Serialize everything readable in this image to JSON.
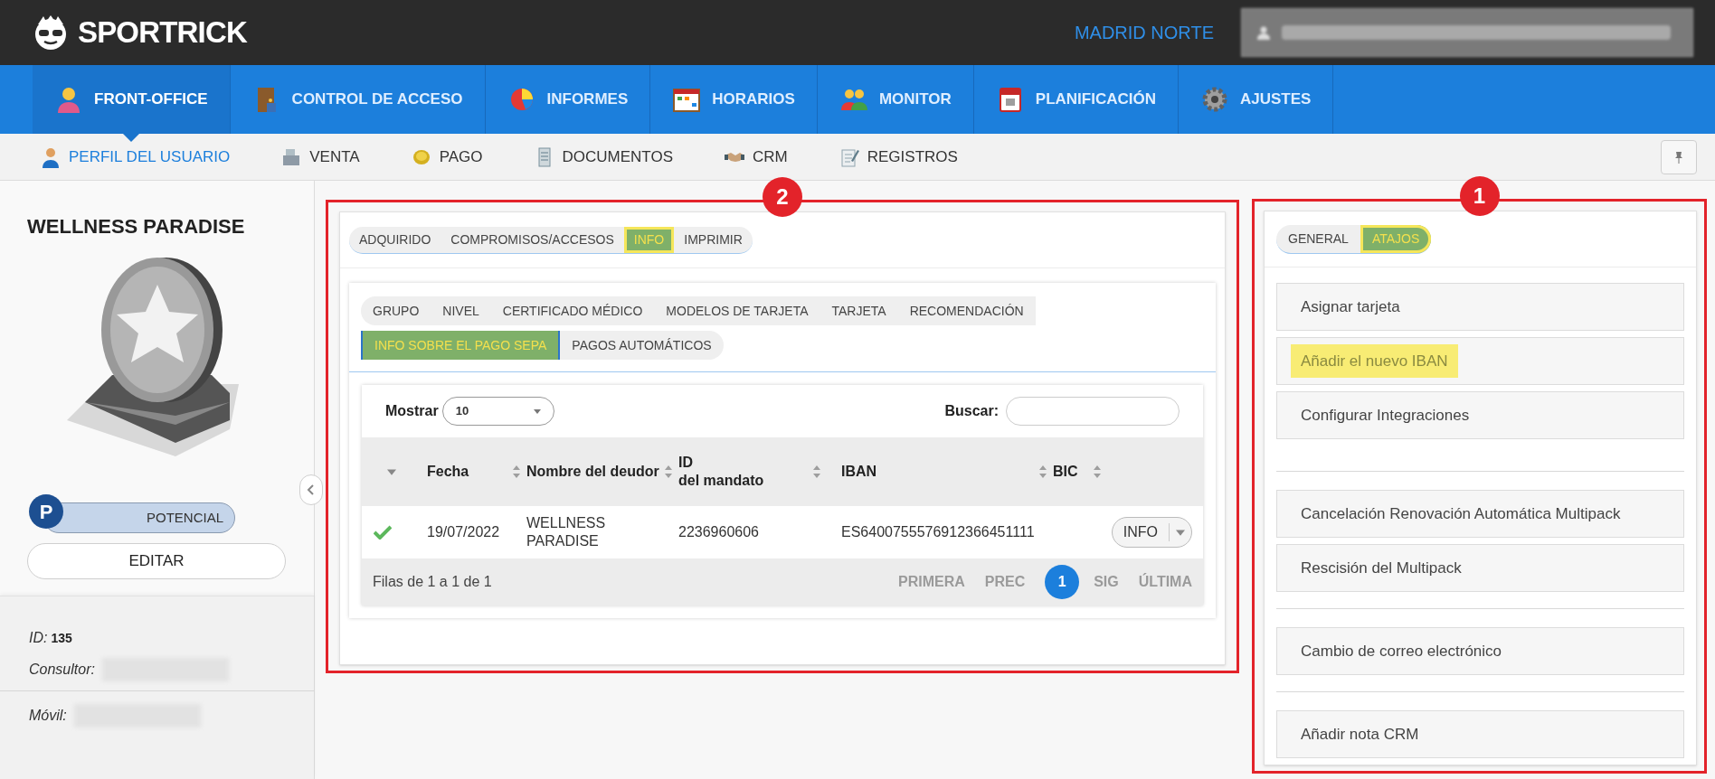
{
  "header": {
    "logo": "SPORTRICK",
    "location": "MADRID NORTE"
  },
  "main_nav": [
    {
      "label": "FRONT-OFFICE",
      "selected": true
    },
    {
      "label": "CONTROL DE ACCESO",
      "selected": false
    },
    {
      "label": "INFORMES",
      "selected": false
    },
    {
      "label": "HORARIOS",
      "selected": false
    },
    {
      "label": "MONITOR",
      "selected": false
    },
    {
      "label": "PLANIFICACIÓN",
      "selected": false
    },
    {
      "label": "AJUSTES",
      "selected": false
    }
  ],
  "sub_nav": [
    {
      "label": "PERFIL DEL USUARIO",
      "selected": true
    },
    {
      "label": "VENTA",
      "selected": false
    },
    {
      "label": "PAGO",
      "selected": false
    },
    {
      "label": "DOCUMENTOS",
      "selected": false
    },
    {
      "label": "CRM",
      "selected": false
    },
    {
      "label": "REGISTROS",
      "selected": false
    }
  ],
  "profile": {
    "name": "WELLNESS PARADISE",
    "badge": "P",
    "status": "POTENCIAL",
    "edit_button": "EDITAR",
    "details": [
      {
        "label": "ID:",
        "value": "135"
      },
      {
        "label": "Consultor:"
      },
      {
        "label": "Móvil:"
      }
    ]
  },
  "info_panel": {
    "callout": "2",
    "tabs": [
      {
        "label": "ADQUIRIDO",
        "selected": false,
        "highlighted": false
      },
      {
        "label": "COMPROMISOS/ACCESOS",
        "selected": false,
        "highlighted": false
      },
      {
        "label": "INFO",
        "selected": true,
        "highlighted": true
      },
      {
        "label": "IMPRIMIR",
        "selected": false,
        "highlighted": false
      }
    ],
    "sub_tabs": [
      [
        {
          "label": "GRUPO",
          "selected": false
        },
        {
          "label": "NIVEL",
          "selected": false
        },
        {
          "label": "CERTIFICADO MÉDICO",
          "selected": false
        },
        {
          "label": "MODELOS DE TARJETA",
          "selected": false
        },
        {
          "label": "TARJETA",
          "selected": false
        },
        {
          "label": "RECOMENDACIÓN",
          "selected": false
        }
      ],
      [
        {
          "label": "INFO SOBRE EL PAGO SEPA",
          "selected": true
        },
        {
          "label": "PAGOS AUTOMÁTICOS",
          "selected": false
        }
      ]
    ],
    "table": {
      "show_label": "Mostrar",
      "page_size": "10",
      "search_label": "Buscar:",
      "columns": [
        "Fecha",
        "Nombre del deudor",
        "ID\ndel mandato",
        "IBAN",
        "BIC"
      ],
      "rows": [
        {
          "confirmed": true,
          "cells": [
            "19/07/2022",
            "WELLNESS PARADISE",
            "2236960606",
            "ES6400755576912366451111",
            ""
          ],
          "action": "INFO"
        }
      ],
      "summary": "Filas de 1 a 1 de 1",
      "pagination": [
        {
          "label": "PRIMERA",
          "selected": false,
          "disabled": true
        },
        {
          "label": "PREC",
          "selected": false,
          "disabled": true
        },
        {
          "label": "1",
          "selected": true,
          "disabled": false
        },
        {
          "label": "SIG",
          "selected": false,
          "disabled": true
        },
        {
          "label": "ÚLTIMA",
          "selected": false,
          "disabled": true
        }
      ]
    }
  },
  "shortcuts_panel": {
    "callout": "1",
    "tabs": [
      {
        "label": "GENERAL",
        "selected": false,
        "highlighted": false
      },
      {
        "label": "ATAJOS",
        "selected": true,
        "highlighted": true
      }
    ],
    "groups": [
      [
        {
          "label": "Asignar tarjeta",
          "highlighted": false
        },
        {
          "label": "Añadir el nuevo IBAN",
          "highlighted": true
        },
        {
          "label": "Configurar Integraciones",
          "highlighted": false
        }
      ],
      [
        {
          "label": "Cancelación Renovación Automática Multipack",
          "highlighted": false
        },
        {
          "label": "Rescisión del Multipack",
          "highlighted": false
        }
      ],
      [
        {
          "label": "Cambio de correo electrónico",
          "highlighted": false
        }
      ],
      [
        {
          "label": "Añadir nota CRM",
          "highlighted": false
        }
      ]
    ]
  }
}
